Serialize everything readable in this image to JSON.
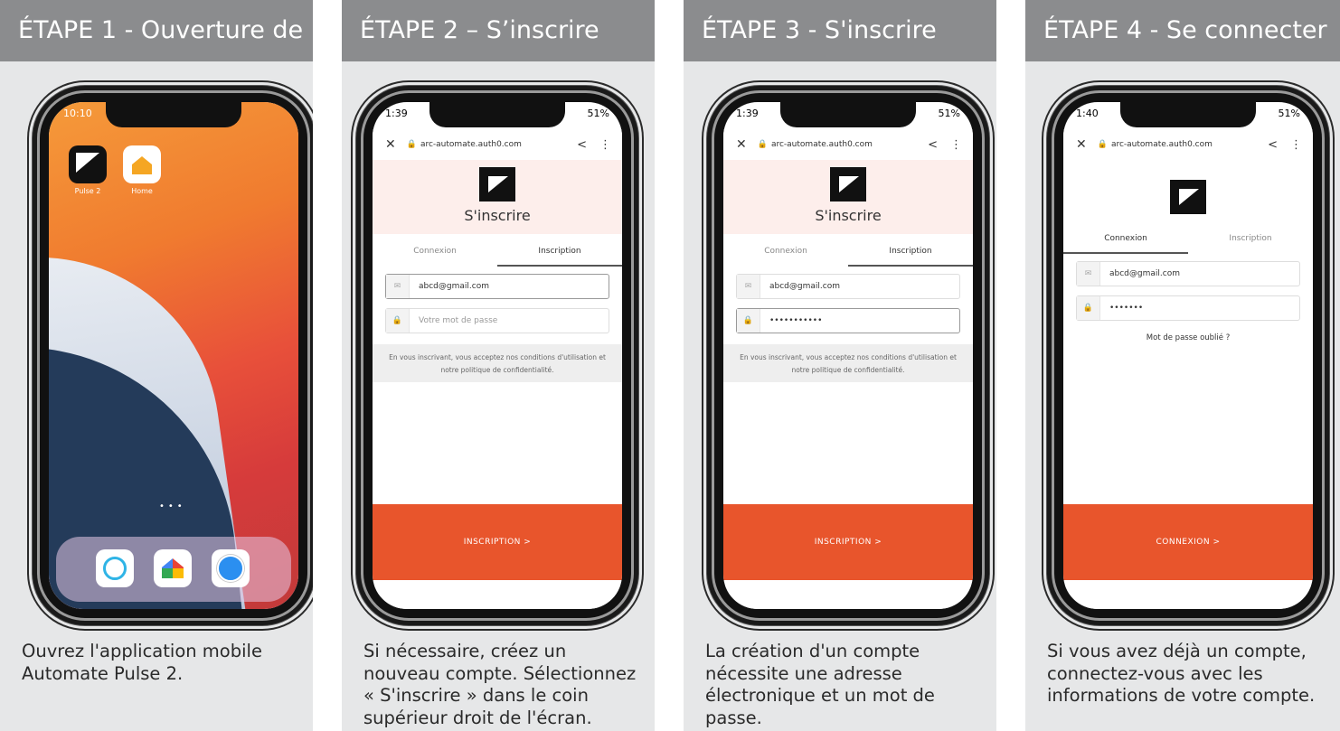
{
  "steps": [
    {
      "title": "ÉTAPE 1 - Ouverture de",
      "description": "Ouvrez l'application mobile Automate Pulse 2.",
      "phone": {
        "time": "10:10",
        "apps": [
          {
            "label": "Pulse 2",
            "icon": "pulse-app-icon"
          },
          {
            "label": "Home",
            "icon": "home-app-icon"
          }
        ],
        "dock": [
          "alexa-icon",
          "google-home-icon",
          "safari-icon"
        ]
      }
    },
    {
      "title": "ÉTAPE 2 – S’inscrire",
      "description": "Si nécessaire, créez un nouveau compte. Sélectionnez « S'inscrire » dans le coin supérieur droit de l'écran.",
      "phone": {
        "time": "1:39",
        "battery": "51%",
        "url": "arc-automate.auth0.com",
        "heading": "S'inscrire",
        "tab_login": "Connexion",
        "tab_signup": "Inscription",
        "email": "abcd@gmail.com",
        "password_placeholder": "Votre mot de passe",
        "terms": "En vous inscrivant, vous acceptez nos conditions d'utilisation et notre politique de confidentialité.",
        "cta": "INSCRIPTION >"
      }
    },
    {
      "title": "ÉTAPE 3 - S'inscrire",
      "description": "La création d'un compte nécessite une adresse électronique et un mot de passe.",
      "phone": {
        "time": "1:39",
        "battery": "51%",
        "url": "arc-automate.auth0.com",
        "heading": "S'inscrire",
        "tab_login": "Connexion",
        "tab_signup": "Inscription",
        "email": "abcd@gmail.com",
        "password": "•••••••••••",
        "terms": "En vous inscrivant, vous acceptez nos conditions d'utilisation et notre politique de confidentialité.",
        "cta": "INSCRIPTION >"
      }
    },
    {
      "title": "ÉTAPE 4 - Se connecter",
      "description": "Si vous avez déjà un compte, connectez-vous avec les informations de votre compte.",
      "phone": {
        "time": "1:40",
        "battery": "51%",
        "url": "arc-automate.auth0.com",
        "tab_login": "Connexion",
        "tab_signup": "Inscription",
        "email": "abcd@gmail.com",
        "password": "•••••••",
        "forgot": "Mot de passe oublié ?",
        "cta": "CONNEXION >"
      }
    }
  ],
  "colors": {
    "header": "#8b8c8e",
    "panel": "#e6e7e8",
    "cta": "#e8552c",
    "hero": "#fdeeeb"
  }
}
